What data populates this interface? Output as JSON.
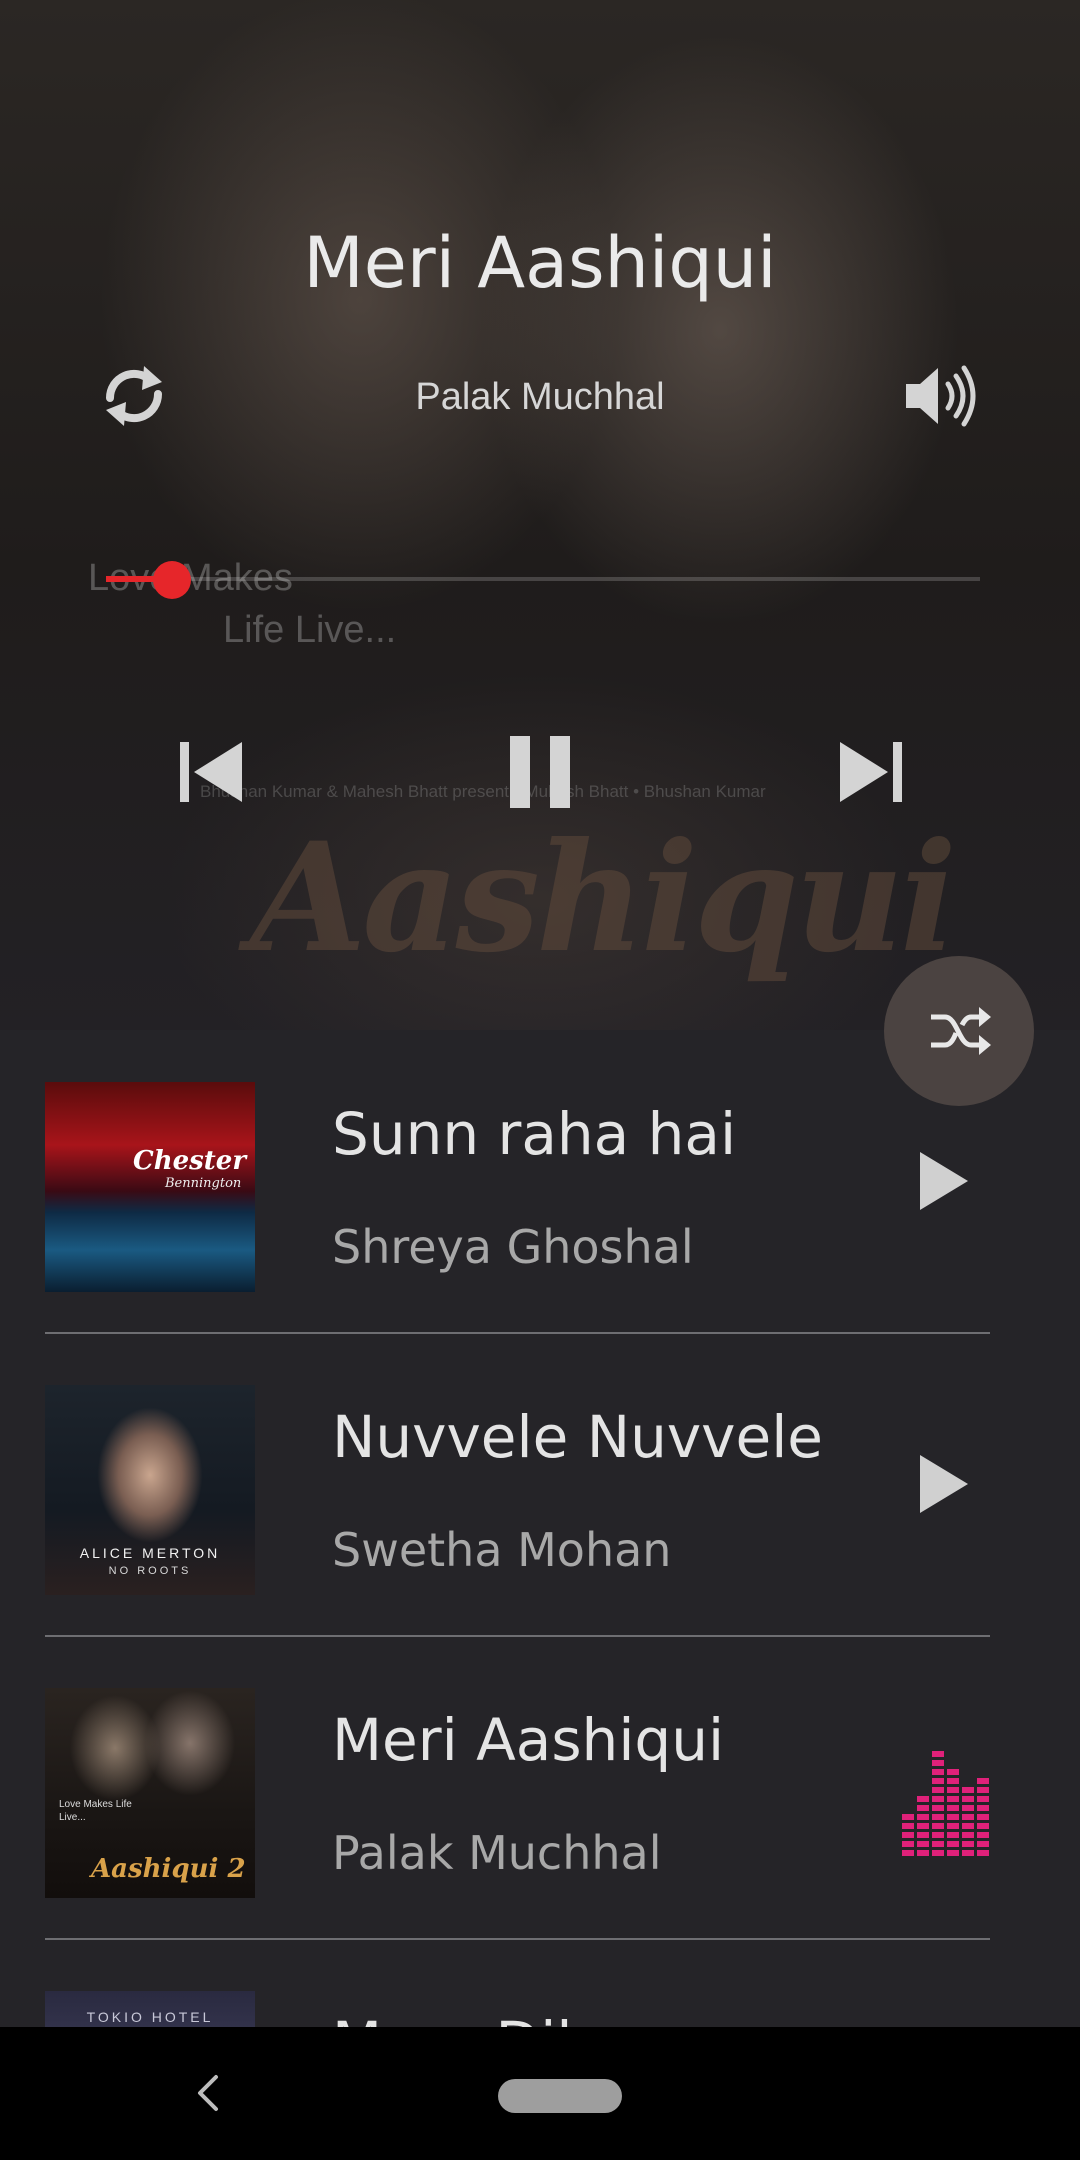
{
  "now_playing": {
    "title": "Meri Aashiqui",
    "artist": "Palak Muchhal",
    "progress": 0.075,
    "artwork": {
      "tagline_line1": "Love Makes",
      "tagline_line2": "Life Live...",
      "credit": "Bhushan Kumar & Mahesh Bhatt present  •  Mukesh Bhatt  •  Bhushan Kumar",
      "logo": "Aashiqui"
    }
  },
  "controls": {
    "repeat_icon": "repeat-icon",
    "volume_icon": "volume-icon",
    "prev_icon": "skip-previous-icon",
    "pause_icon": "pause-icon",
    "next_icon": "skip-next-icon",
    "shuffle_icon": "shuffle-icon"
  },
  "colors": {
    "accent": "#e6262a",
    "equalizer": "#e0217a",
    "list_background": "#252428",
    "fab": "#4b4341"
  },
  "playlist": [
    {
      "title": "Sunn raha hai",
      "artist": "Shreya Ghoshal",
      "art_text": "Chester",
      "art_subtext": "Bennington",
      "state": "play"
    },
    {
      "title": "Nuvvele Nuvvele",
      "artist": "Swetha Mohan",
      "art_text": "ALICE MERTON",
      "art_subtext": "NO ROOTS",
      "state": "play"
    },
    {
      "title": "Meri Aashiqui",
      "artist": "Palak Muchhal",
      "art_text": "Aashiqui 2",
      "art_subtext": "Love Makes Life Live...",
      "state": "playing"
    },
    {
      "title": "Mera Dil",
      "artist": "",
      "art_text": "TOKIO HOTEL",
      "art_subtext": "",
      "state": "play"
    }
  ]
}
